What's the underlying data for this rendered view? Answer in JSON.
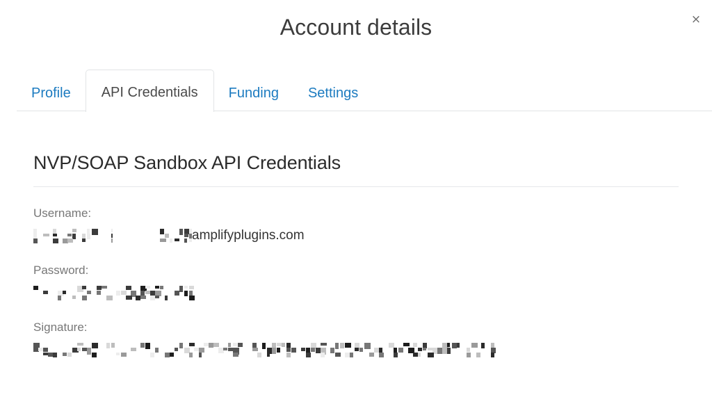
{
  "modal": {
    "title": "Account details",
    "close_icon": "close-icon",
    "close_label": "×"
  },
  "tabs": [
    {
      "label": "Profile",
      "active": false
    },
    {
      "label": "API Credentials",
      "active": true
    },
    {
      "label": "Funding",
      "active": false
    },
    {
      "label": "Settings",
      "active": false
    }
  ],
  "main": {
    "heading": "NVP/SOAP Sandbox API Credentials",
    "fields": [
      {
        "label": "Username:",
        "redacted": true,
        "visible_text": "amplifyplugins.com",
        "value_layout": "redacted-then-text"
      },
      {
        "label": "Password:",
        "redacted": true,
        "visible_text": "",
        "value_layout": "fully-redacted"
      },
      {
        "label": "Signature:",
        "redacted": true,
        "visible_text": "",
        "value_layout": "fully-redacted"
      }
    ]
  },
  "colors": {
    "link": "#1c7bc0",
    "active_tab_text": "#4a4a4a",
    "title": "#3c3c3c",
    "label": "#777777",
    "border": "#e2e4e6",
    "background": "#ffffff"
  }
}
